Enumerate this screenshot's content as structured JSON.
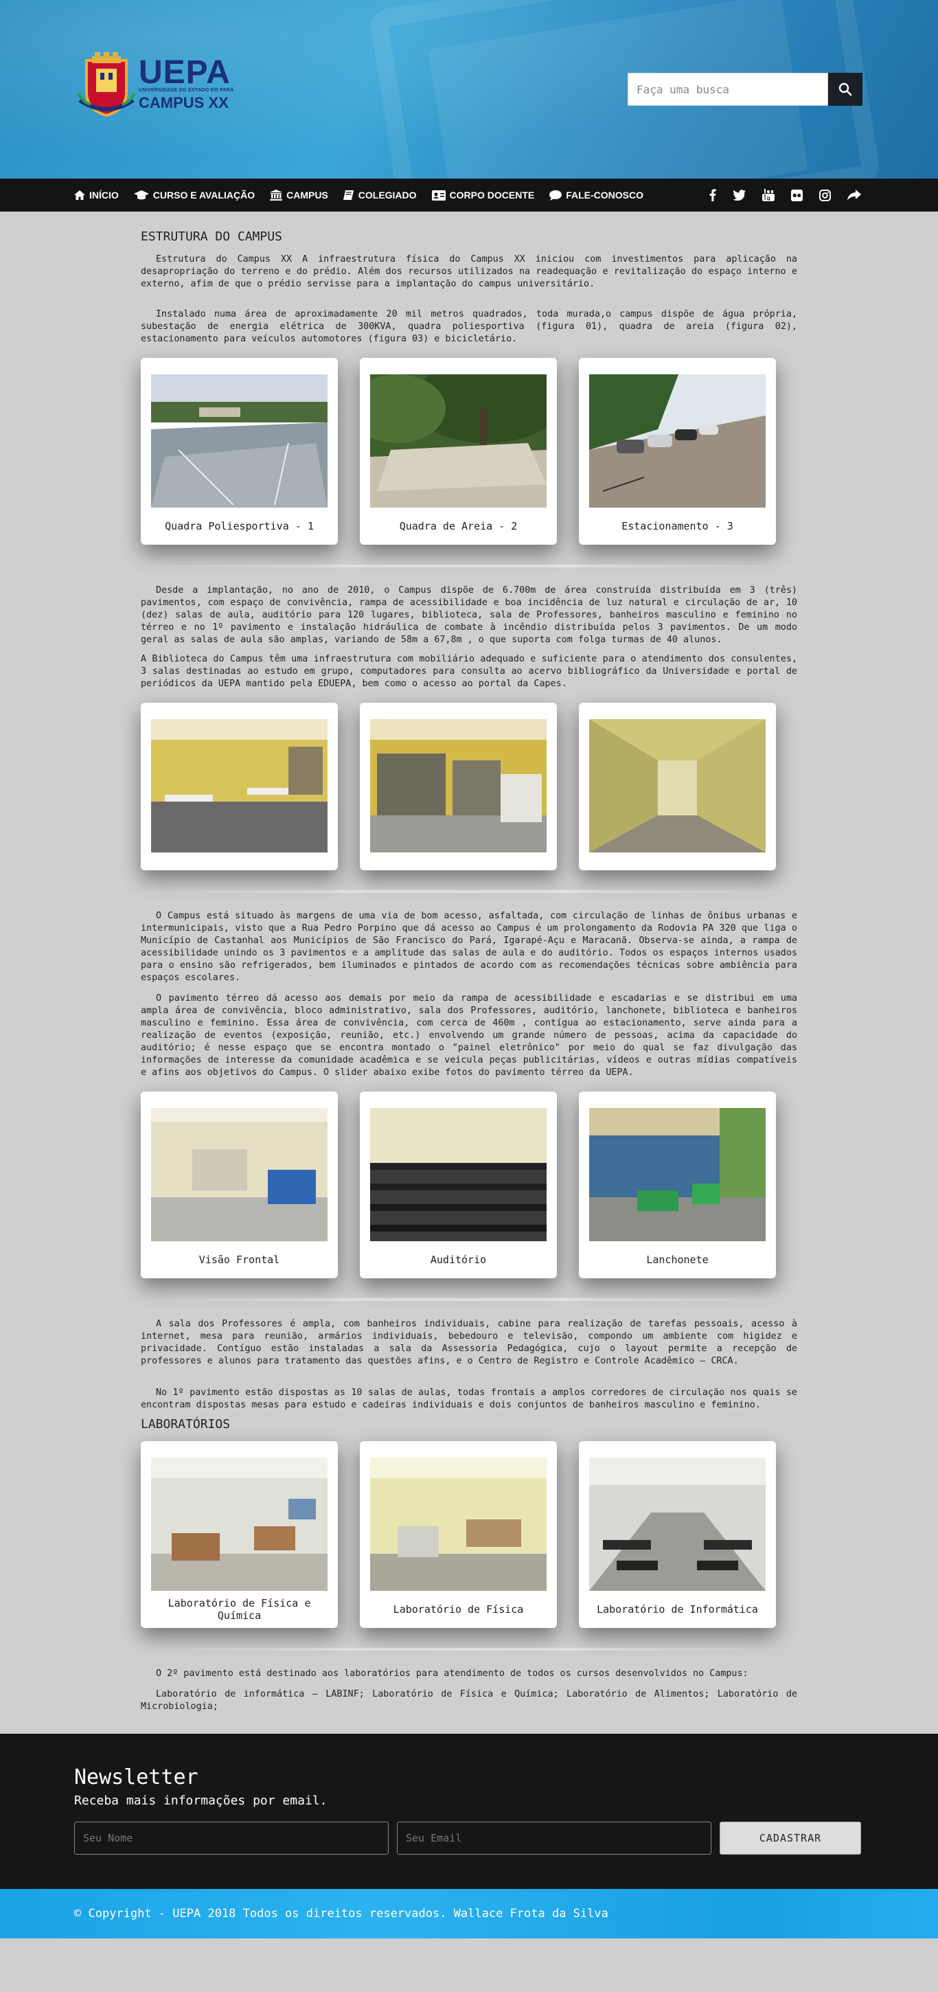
{
  "header": {
    "logo_title": "UEPA",
    "logo_subtitle": "UNIVERSIDADE DO ESTADO DO PARÁ",
    "logo_campus": "CAMPUS XX",
    "search_placeholder": "Faça uma busca"
  },
  "nav": {
    "items": [
      {
        "label": "INÍCIO",
        "icon": "home-icon"
      },
      {
        "label": "CURSO E AVALIAÇÃO",
        "icon": "graduation-cap-icon"
      },
      {
        "label": "CAMPUS",
        "icon": "university-icon"
      },
      {
        "label": "COLEGIADO",
        "icon": "book-icon"
      },
      {
        "label": "CORPO DOCENTE",
        "icon": "id-card-icon"
      },
      {
        "label": "FALE-CONOSCO",
        "icon": "chat-icon"
      }
    ],
    "social": [
      "facebook-icon",
      "twitter-icon",
      "youtube-icon",
      "flickr-icon",
      "instagram-icon",
      "share-icon"
    ]
  },
  "content": {
    "title1": "ESTRUTURA DO CAMPUS",
    "p1": "Estrutura do Campus XX A infraestrutura física do Campus XX iniciou com investimentos para aplicação na desapropriação do terreno e do prédio. Além dos recursos utilizados na readequação e revitalização do espaço interno e externo, afim de que o prédio servisse para a implantação do campus universitário.",
    "p2": "Instalado numa área de aproximadamente 20 mil metros quadrados, toda murada,o campus dispõe de água própria, subestação de energia elétrica de 300KVA, quadra poliesportiva (figura 01), quadra de areia (figura 02), estacionamento para veículos automotores (figura 03) e bicicletário.",
    "gallery1": [
      "Quadra Poliesportiva - 1",
      "Quadra de Areia - 2",
      "Estacionamento - 3"
    ],
    "p3": "Desde a implantação, no ano de 2010, o Campus dispõe de 6.700m   de área construída distribuída em 3 (três) pavimentos, com espaço de convivência, rampa de acessibilidade e boa incidência de luz natural e circulação de ar, 10 (dez) salas de aula, auditório para 120 lugares, biblioteca, sala de Professores, banheiros masculino e feminino no térreo e no 1º pavimento e instalação hidráulica de combate à incêndio distribuída pelos 3 pavimentos. De um modo geral as salas de aula são amplas, variando de 58m   a 67,8m  , o que suporta com folga turmas de 40 alunos.",
    "p4": "A Biblioteca do Campus têm uma infraestrutura com mobiliário adequado e suficiente para o atendimento dos consulentes, 3 salas destinadas ao estudo em grupo, computadores para consulta ao acervo bibliográfico da Universidade e portal de periódicos da UEPA mantido pela EDUEPA, bem como o acesso ao portal da Capes.",
    "p5": "O Campus está situado às margens de uma via de bom acesso, asfaltada, com circulação de linhas de ônibus urbanas e intermunicipais, visto que a Rua Pedro Porpino que dá acesso ao Campus é um prolongamento da Rodovia PA 320 que liga o Município de Castanhal aos Municípios de São Francisco do Pará, Igarapé-Açu e Maracanã. Observa-se ainda, a rampa de acessibilidade unindo os 3 pavimentos e a amplitude das salas de aula e do auditório. Todos os espaços internos usados para o ensino são refrigerados, bem iluminados e pintados de acordo com as recomendações técnicas sobre ambiência para espaços escolares.",
    "p6": "O pavimento térreo dá acesso aos demais por meio da rampa de acessibilidade e escadarias e se distribui em uma ampla área de convivência, bloco administrativo, sala dos Professores, auditório, lanchonete, biblioteca e banheiros masculino e feminino. Essa área de convivência, com cerca de 460m  , contígua ao estacionamento, serve ainda para a realização de eventos (exposição, reunião, etc.) envolvendo um grande número de pessoas, acima da capacidade do auditório; é nesse espaço que se encontra montado o  \"painel eletrônico\" por meio do qual se faz divulgação das informações de interesse da comunidade acadêmica e se veicula peças publicitárias, vídeos e outras mídias compatíveis e afins aos objetivos do Campus. O slider abaixo exibe fotos do pavimento térreo da UEPA.",
    "gallery3": [
      "Visão Frontal",
      "Auditório",
      "Lanchonete"
    ],
    "p7": "A sala dos Professores é ampla, com banheiros individuais, cabine para realização de tarefas pessoais, acesso à internet, mesa para reunião, armários individuais, bebedouro e televisão, compondo um ambiente com higidez e privacidade. Contíguo estão instaladas a sala da Assessoria Pedagógica, cujo o layout permite a recepção de professores e alunos para tratamento das questões afins, e o Centro de Registro e Controle Acadêmico – CRCA.",
    "p8": "No 1º pavimento estão dispostas as 10 salas de aulas, todas frontais a amplos corredores de circulação nos quais se encontram dispostas mesas para estudo e cadeiras individuais e dois conjuntos de banheiros masculino e feminino.",
    "title2": "LABORATÓRIOS",
    "gallery4": [
      "Laboratório de Física e Química",
      "Laboratório de Física",
      "Laboratório de Informática"
    ],
    "p9": "O 2º pavimento está destinado aos laboratórios para atendimento de todos os cursos desenvolvidos no Campus:",
    "p10": "Laboratório de informática – LABINF; Laboratório de Física e Química; Laboratório de Alimentos; Laboratório de Microbiologia;"
  },
  "newsletter": {
    "title": "Newsletter",
    "lead": "Receba mais informações por email.",
    "name_placeholder": "Seu Nome",
    "email_placeholder": "Seu Email",
    "button": "CADASTRAR"
  },
  "footer": {
    "copyright": "© Copyright - UEPA 2018 Todos os direitos reservados. Wallace Frota da Silva"
  },
  "colors": {
    "header_blue": "#2a8fc2",
    "nav_bg": "#141414",
    "footer_blue": "#1aa3e6",
    "logo_navy": "#1b2f7e"
  }
}
